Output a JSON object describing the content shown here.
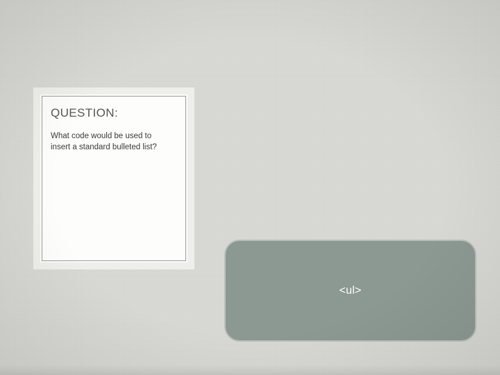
{
  "question": {
    "title": "QUESTION:",
    "body": "What code would be used to insert a standard bulleted list?"
  },
  "answer": {
    "text": "<ul>"
  }
}
